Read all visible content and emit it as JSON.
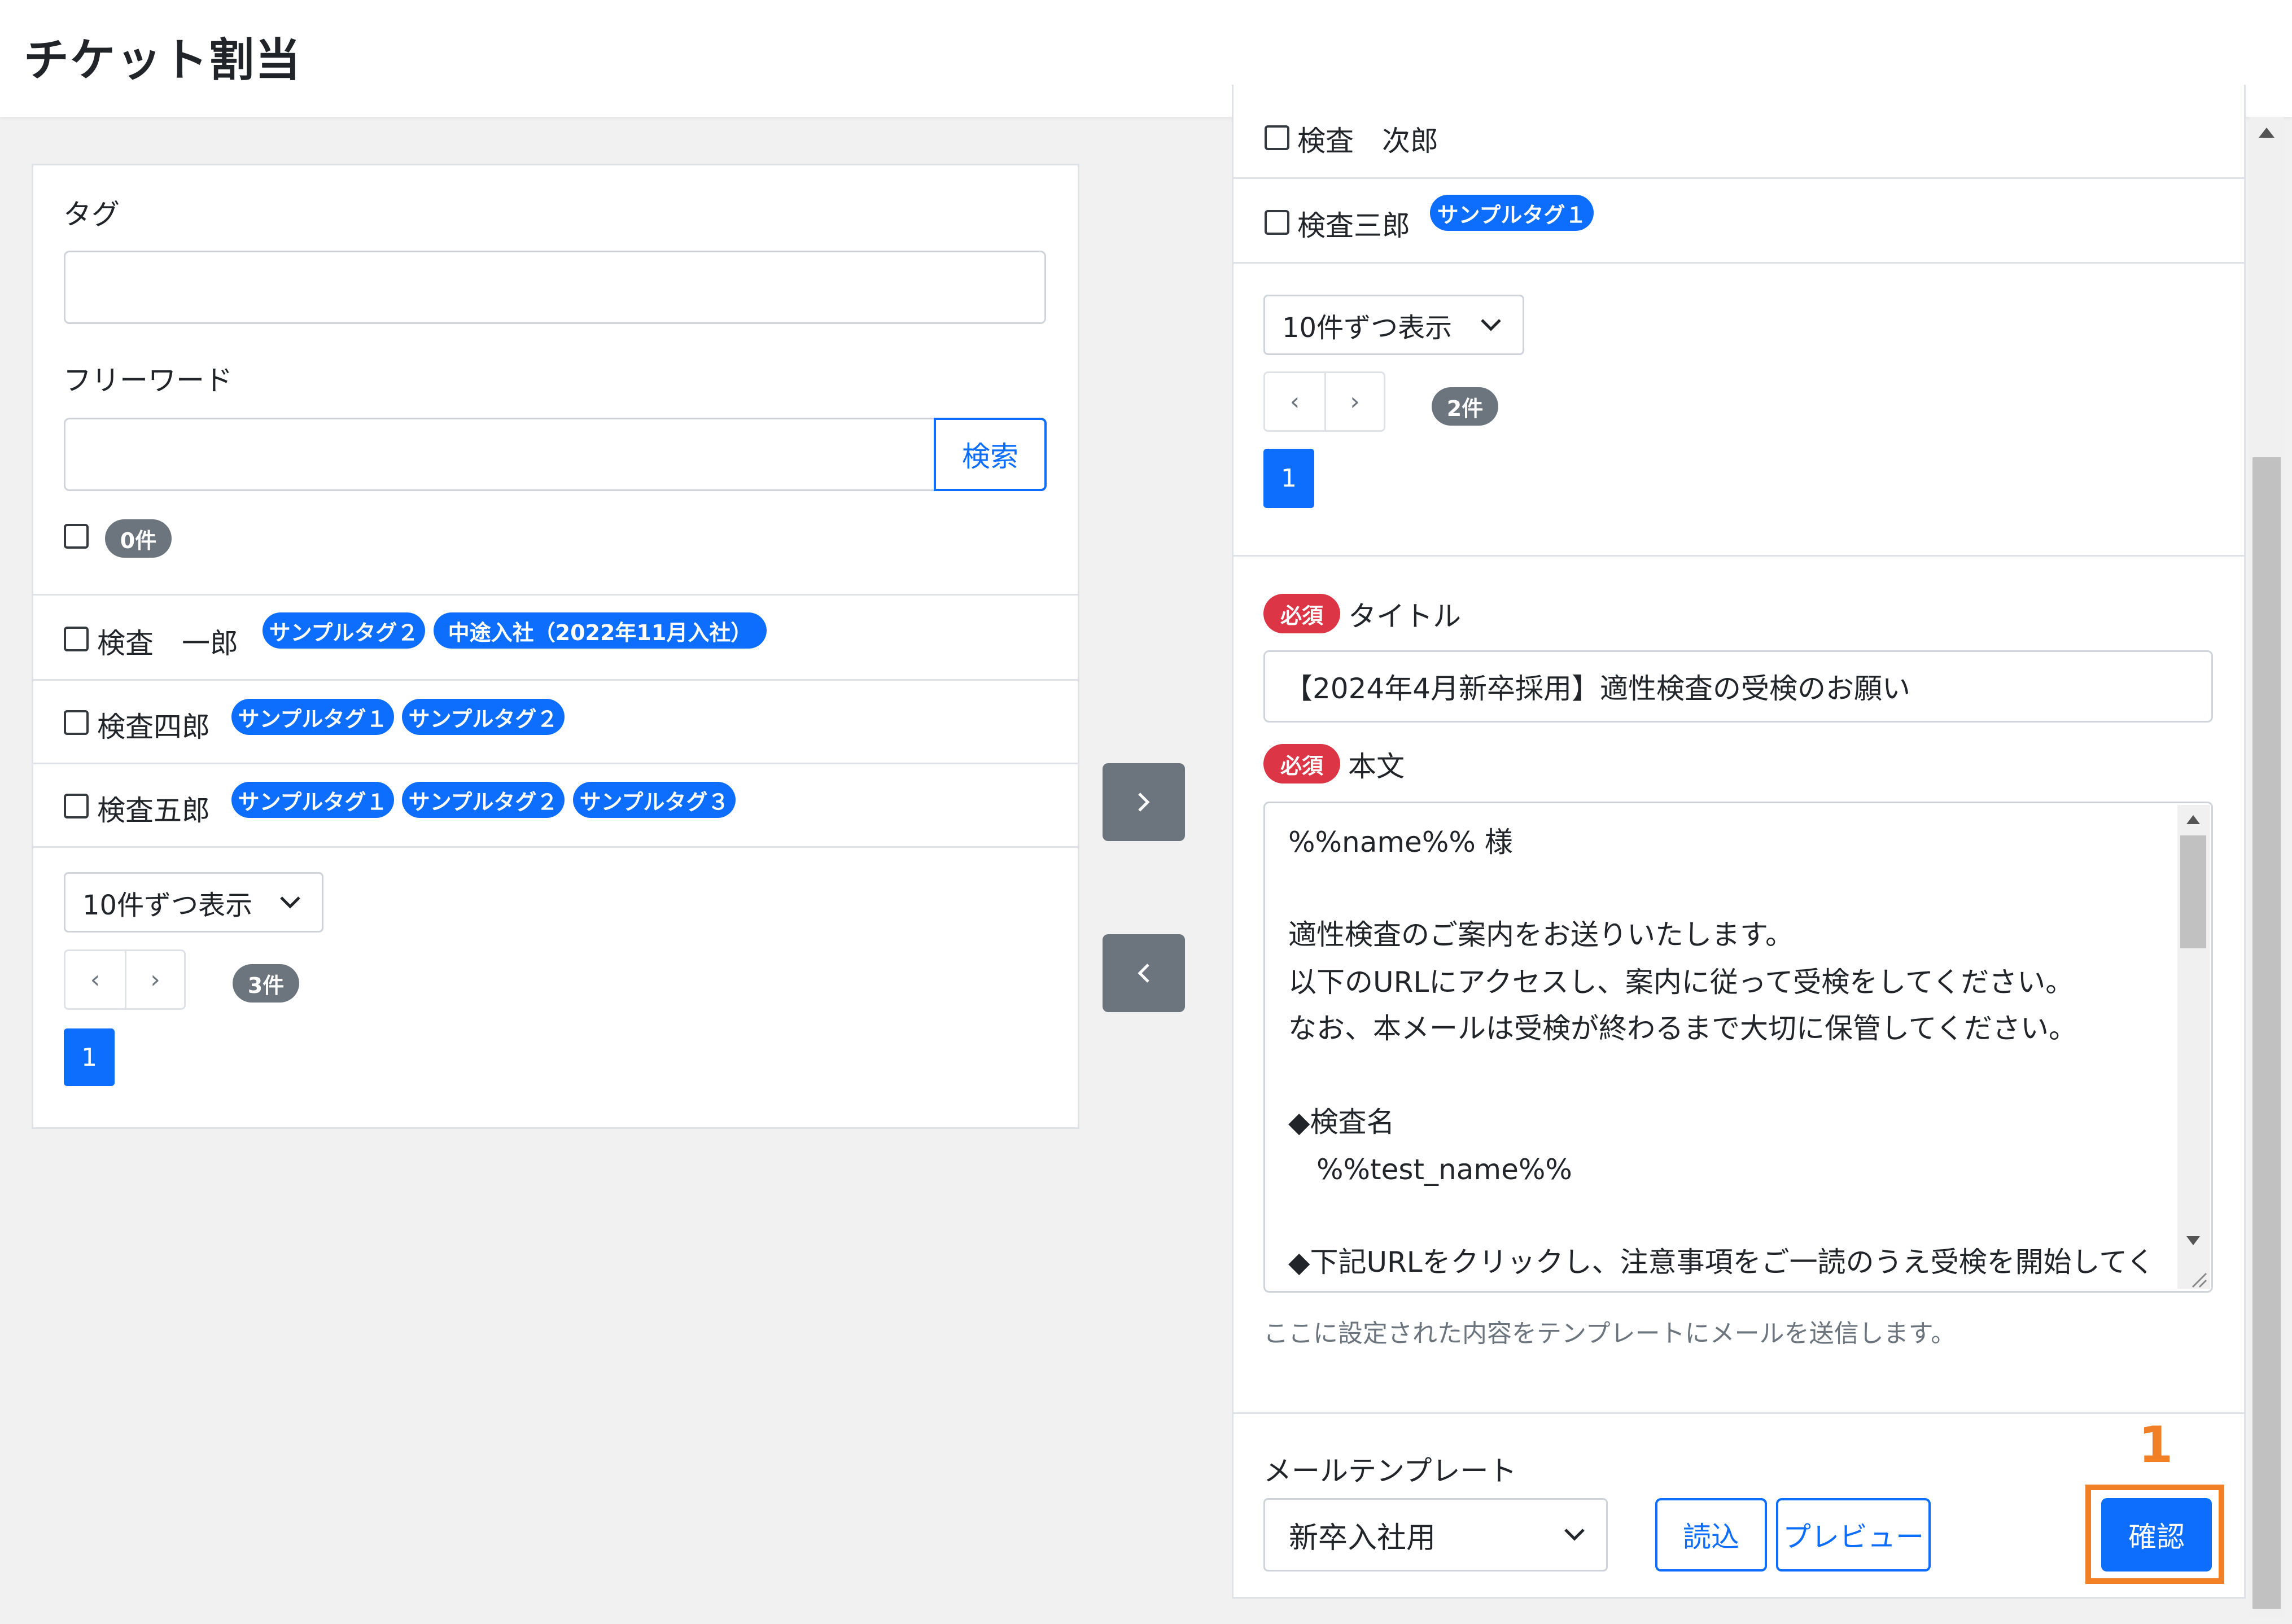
{
  "header": {
    "title": "チケット割当"
  },
  "left_panel": {
    "tag_label": "タグ",
    "tag_value": "",
    "freeword_label": "フリーワード",
    "freeword_value": "",
    "search_button": "検索",
    "selected_count": "0件",
    "users": [
      {
        "name": "検査　一郎",
        "tags": [
          "サンプルタグ２",
          "中途入社（2022年11月入社）"
        ]
      },
      {
        "name": "検査四郎",
        "tags": [
          "サンプルタグ１",
          "サンプルタグ２"
        ]
      },
      {
        "name": "検査五郎",
        "tags": [
          "サンプルタグ１",
          "サンプルタグ２",
          "サンプルタグ３"
        ]
      }
    ],
    "page_size": "10件ずつ表示",
    "prev": "‹",
    "next": "›",
    "total": "3件",
    "current_page": "1"
  },
  "right_panel": {
    "users": [
      {
        "name": "検査　次郎",
        "tags": []
      },
      {
        "name": "検査三郎",
        "tags": [
          "サンプルタグ１"
        ]
      }
    ],
    "page_size": "10件ずつ表示",
    "prev": "‹",
    "next": "›",
    "total": "2件",
    "current_page": "1",
    "required_badge": "必須",
    "title_label": "タイトル",
    "title_value": "【2024年4月新卒採用】適性検査の受検のお願い",
    "body_label": "本文",
    "body_lines": [
      "%%name%% 様",
      "",
      "適性検査のご案内をお送りいたします。",
      "以下のURLにアクセスし、案内に従って受検をしてください。",
      "なお、本メールは受検が終わるまで大切に保管してください。",
      "",
      "◆検査名",
      "　%%test_name%%",
      "",
      "◆下記URLをクリックし、注意事項をご一読のうえ受検を開始してくださ"
    ],
    "help_text": "ここに設定された内容をテンプレートにメールを送信します。",
    "template_label": "メールテンプレート",
    "template_value": "新卒入社用",
    "load_button": "読込",
    "preview_button": "プレビュー",
    "confirm_button": "確認"
  },
  "annotation": {
    "step_number": "1",
    "color": "#f07f25"
  },
  "colors": {
    "primary": "#0d6efd",
    "secondary": "#6c757d",
    "danger": "#dc3545"
  }
}
